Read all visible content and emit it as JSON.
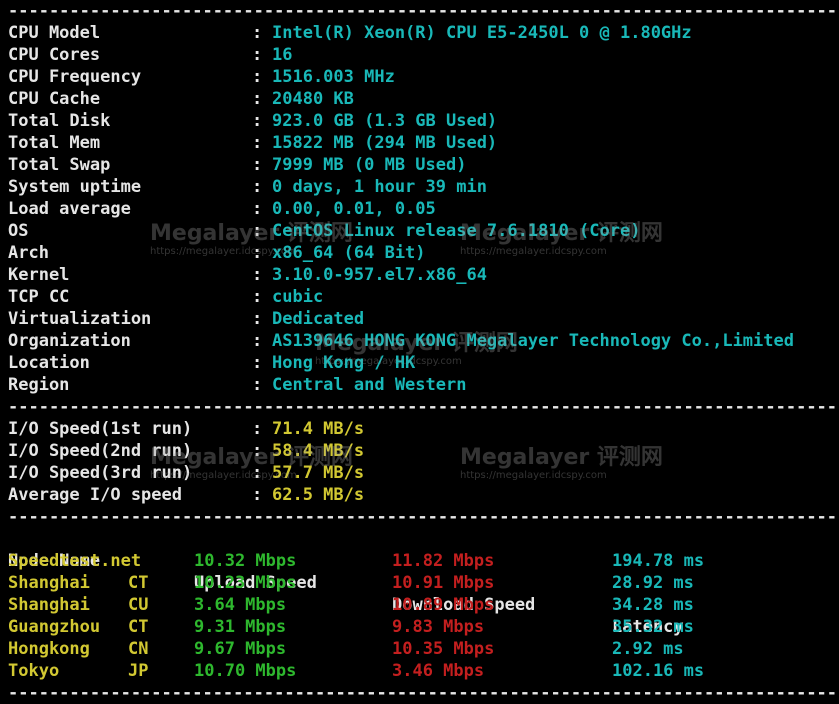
{
  "separator": "------------------------------------------------------------------------------------------",
  "system_info": [
    {
      "label": "CPU Model",
      "value": "Intel(R) Xeon(R) CPU E5-2450L 0 @ 1.80GHz"
    },
    {
      "label": "CPU Cores",
      "value": "16"
    },
    {
      "label": "CPU Frequency",
      "value": "1516.003 MHz"
    },
    {
      "label": "CPU Cache",
      "value": "20480 KB"
    },
    {
      "label": "Total Disk",
      "value": "923.0 GB (1.3 GB Used)"
    },
    {
      "label": "Total Mem",
      "value": "15822 MB (294 MB Used)"
    },
    {
      "label": "Total Swap",
      "value": "7999 MB (0 MB Used)"
    },
    {
      "label": "System uptime",
      "value": "0 days, 1 hour 39 min"
    },
    {
      "label": "Load average",
      "value": "0.00, 0.01, 0.05"
    },
    {
      "label": "OS",
      "value": "CentOS Linux release 7.6.1810 (Core)"
    },
    {
      "label": "Arch",
      "value": "x86_64 (64 Bit)"
    },
    {
      "label": "Kernel",
      "value": "3.10.0-957.el7.x86_64"
    },
    {
      "label": "TCP CC",
      "value": "cubic"
    },
    {
      "label": "Virtualization",
      "value": "Dedicated"
    },
    {
      "label": "Organization",
      "value": "AS139646 HONG KONG Megalayer Technology Co.,Limited"
    },
    {
      "label": "Location",
      "value": "Hong Kong / HK"
    },
    {
      "label": "Region",
      "value": "Central and Western"
    }
  ],
  "colon": ":",
  "io_tests": [
    {
      "label": "I/O Speed(1st run)",
      "value": "71.4 MB/s"
    },
    {
      "label": "I/O Speed(2nd run)",
      "value": "58.4 MB/s"
    },
    {
      "label": "I/O Speed(3rd run)",
      "value": "57.7 MB/s"
    },
    {
      "label": "Average I/O speed",
      "value": "62.5 MB/s"
    }
  ],
  "speed_header": {
    "node": "Node Name",
    "upload": "Upload Speed",
    "download": "Download Speed",
    "latency": "Latency"
  },
  "speed_rows": [
    {
      "node": "Speedtest.net",
      "isp": "",
      "upload": "10.32 Mbps",
      "download": "11.82 Mbps",
      "latency": "194.78 ms"
    },
    {
      "node": "Shanghai",
      "isp": "CT",
      "upload": "10.23 Mbps",
      "download": "10.91 Mbps",
      "latency": "28.92 ms"
    },
    {
      "node": "Shanghai",
      "isp": "CU",
      "upload": "3.64 Mbps",
      "download": "10.89 Mbps",
      "latency": "34.28 ms"
    },
    {
      "node": "Guangzhou",
      "isp": "CT",
      "upload": "9.31 Mbps",
      "download": "9.83 Mbps",
      "latency": "35.32 ms"
    },
    {
      "node": "Hongkong",
      "isp": "CN",
      "upload": "9.67 Mbps",
      "download": "10.35 Mbps",
      "latency": "2.92 ms"
    },
    {
      "node": "Tokyo",
      "isp": "JP",
      "upload": "10.70 Mbps",
      "download": "3.46 Mbps",
      "latency": "102.16 ms"
    }
  ],
  "watermark": {
    "brand": "Megalayer 评测网",
    "url": "https://megalayer.idcspy.com"
  },
  "colors": {
    "background": "#000000",
    "label": "#e6e6e6",
    "cyan": "#19b8b8",
    "yellow": "#d2c832",
    "green": "#2eb82e",
    "red": "#c41f1f"
  }
}
